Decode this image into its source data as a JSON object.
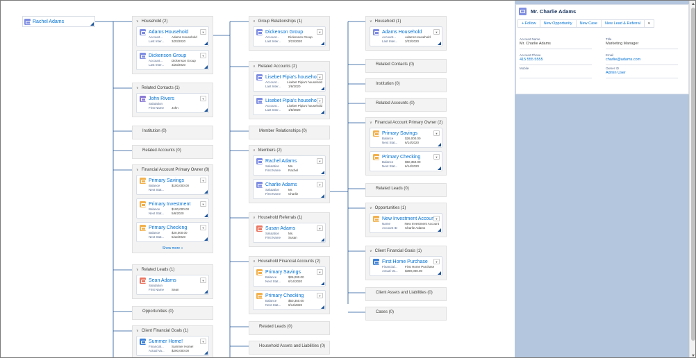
{
  "root": {
    "name": "Rachel Adams",
    "icon": "household-icon"
  },
  "columns": [
    {
      "groups": [
        {
          "title": "Household (2)",
          "cards": [
            {
              "icon": "household-icon",
              "color": "blue",
              "name": "Adams Household",
              "fields": [
                [
                  "Account...",
                  "Adams Household"
                ],
                [
                  "Last Inter...",
                  "3/23/2020"
                ]
              ]
            },
            {
              "icon": "household-icon",
              "color": "blue",
              "name": "Dickenson Group",
              "fields": [
                [
                  "Account...",
                  "Dickenson Group"
                ],
                [
                  "Last Inter...",
                  "3/23/2020"
                ]
              ]
            }
          ]
        },
        {
          "title": "Related Contacts (1)",
          "cards": [
            {
              "icon": "contact-icon",
              "color": "purple",
              "name": "John Rivers",
              "fields": [
                [
                  "Salutation",
                  ""
                ],
                [
                  "First Name",
                  "John"
                ]
              ]
            }
          ]
        },
        {
          "title": "Institution (0)",
          "cards": []
        },
        {
          "title": "Related Accounts (0)",
          "cards": []
        },
        {
          "title": "Financial Account Primary Owner (8)",
          "show_more": "Show more »",
          "cards": [
            {
              "icon": "financial-account-icon",
              "color": "orange",
              "name": "Primary Savings",
              "fields": [
                [
                  "Balance",
                  "$100,000.00"
                ],
                [
                  "Next Stat...",
                  ""
                ]
              ]
            },
            {
              "icon": "financial-account-icon",
              "color": "orange",
              "name": "Primary Investment",
              "fields": [
                [
                  "Balance",
                  "$100,000.00"
                ],
                [
                  "Next Stat...",
                  "5/6/2020"
                ]
              ]
            },
            {
              "icon": "financial-account-icon",
              "color": "orange",
              "name": "Primary Checking",
              "fields": [
                [
                  "Balance",
                  "$20,000.00"
                ],
                [
                  "Next Stat...",
                  "5/12/2020"
                ]
              ]
            }
          ]
        },
        {
          "title": "Related Leads (1)",
          "cards": [
            {
              "icon": "lead-icon",
              "color": "red",
              "name": "Sean Adams",
              "fields": [
                [
                  "Salutation",
                  ""
                ],
                [
                  "First Name",
                  "Sean"
                ]
              ]
            }
          ]
        },
        {
          "title": "Opportunities (0)",
          "cards": []
        },
        {
          "title": "Client Financial Goals (1)",
          "cards": [
            {
              "icon": "goal-icon",
              "color": "sblue",
              "name": "Summer Home!",
              "fields": [
                [
                  "Financial...",
                  "Summer Home!"
                ],
                [
                  "Actual Va...",
                  "$290,000.00"
                ]
              ]
            }
          ]
        }
      ]
    },
    {
      "groups": [
        {
          "title": "Group Relationships (1)",
          "cards": [
            {
              "icon": "household-icon",
              "color": "blue",
              "name": "Dickenson Group",
              "fields": [
                [
                  "Account...",
                  "Dickenson Group"
                ],
                [
                  "Last Inter...",
                  "3/23/2020"
                ]
              ]
            }
          ]
        },
        {
          "title": "Related Accounts (2)",
          "cards": [
            {
              "icon": "household-icon",
              "color": "blue",
              "name": "Lisebet Pipia's household",
              "fields": [
                [
                  "Account...",
                  "Lisebet Pipia's household"
                ],
                [
                  "Last Inter...",
                  "1/8/2020"
                ]
              ]
            },
            {
              "icon": "household-icon",
              "color": "blue",
              "name": "Lisebet Pipia's household",
              "fields": [
                [
                  "Account...",
                  "Lisebet Pipia's household"
                ],
                [
                  "Last Inter...",
                  "1/8/2020"
                ]
              ]
            }
          ]
        },
        {
          "title": "Member Relationships (0)",
          "cards": []
        },
        {
          "title": "Members (2)",
          "cards": [
            {
              "icon": "contact-icon",
              "color": "blue",
              "name": "Rachel Adams",
              "fields": [
                [
                  "Salutation",
                  "Ms."
                ],
                [
                  "First Name",
                  "Rachel"
                ]
              ]
            },
            {
              "icon": "contact-icon",
              "color": "blue",
              "name": "Charlie Adams",
              "fields": [
                [
                  "Salutation",
                  "Mr."
                ],
                [
                  "First Name",
                  "Charlie"
                ]
              ]
            }
          ]
        },
        {
          "title": "Household Referrals (1)",
          "cards": [
            {
              "icon": "lead-icon",
              "color": "red",
              "name": "Susan Adams",
              "fields": [
                [
                  "Salutation",
                  "Ms."
                ],
                [
                  "First Name",
                  "Susan"
                ]
              ]
            }
          ]
        },
        {
          "title": "Household Financial Accounts (2)",
          "cards": [
            {
              "icon": "financial-account-icon",
              "color": "orange",
              "name": "Primary Savings",
              "fields": [
                [
                  "Balance",
                  "$26,000.00"
                ],
                [
                  "Next Stat...",
                  "6/14/2020"
                ]
              ]
            },
            {
              "icon": "financial-account-icon",
              "color": "orange",
              "name": "Primary Checking",
              "fields": [
                [
                  "Balance",
                  "$50,350.00"
                ],
                [
                  "Next Stat...",
                  "6/14/2020"
                ]
              ]
            }
          ]
        },
        {
          "title": "Related Leads (0)",
          "cards": []
        },
        {
          "title": "Household Assets and Liabilities (0)",
          "cards": []
        }
      ]
    },
    {
      "groups": [
        {
          "title": "Household (1)",
          "cards": [
            {
              "icon": "household-icon",
              "color": "blue",
              "name": "Adams Household",
              "fields": [
                [
                  "Account...",
                  "Adams Household"
                ],
                [
                  "Last Inter...",
                  "3/23/2020"
                ]
              ]
            }
          ]
        },
        {
          "title": "Related Contacts (0)",
          "cards": []
        },
        {
          "title": "Institution (0)",
          "cards": []
        },
        {
          "title": "Related Accounts (0)",
          "cards": []
        },
        {
          "title": "Financial Account Primary Owner (2)",
          "cards": [
            {
              "icon": "financial-account-icon",
              "color": "orange",
              "name": "Primary Savings",
              "fields": [
                [
                  "Balance",
                  "$26,000.00"
                ],
                [
                  "Next Stat...",
                  "6/14/2020"
                ]
              ]
            },
            {
              "icon": "financial-account-icon",
              "color": "orange",
              "name": "Primary Checking",
              "fields": [
                [
                  "Balance",
                  "$50,350.00"
                ],
                [
                  "Next Stat...",
                  "6/14/2020"
                ]
              ]
            }
          ]
        },
        {
          "title": "Related Leads (0)",
          "cards": []
        },
        {
          "title": "Opportunities (1)",
          "cards": [
            {
              "icon": "opportunity-icon",
              "color": "orange",
              "name": "New Investment Account",
              "fields": [
                [
                  "Name",
                  "New Investment Account"
                ],
                [
                  "Account ID",
                  "Charlie Adams"
                ]
              ]
            }
          ]
        },
        {
          "title": "Client Financial Goals (1)",
          "cards": [
            {
              "icon": "goal-icon",
              "color": "sblue",
              "name": "First Home Purchase",
              "fields": [
                [
                  "Financial...",
                  "First Home Purchase"
                ],
                [
                  "Actual Va...",
                  "$390,000.00"
                ]
              ]
            }
          ]
        },
        {
          "title": "Client Assets and Liabilities (0)",
          "cards": []
        },
        {
          "title": "Cases (0)",
          "cards": []
        }
      ]
    }
  ],
  "detail": {
    "title": "Mr. Charlie Adams",
    "icon": "contact-icon",
    "actions": [
      "+ Follow",
      "New Opportunity",
      "New Case",
      "New Lead & Referral"
    ],
    "menu_glyph": "▾",
    "fields": [
      {
        "label": "Account Name",
        "value": "Mr. Charlie Adams",
        "link": false
      },
      {
        "label": "Title",
        "value": "Marketing Manager",
        "link": false
      },
      {
        "label": "Account Phone",
        "value": "415 555 5555",
        "link": true
      },
      {
        "label": "Email",
        "value": "charlie@adams.com",
        "link": true
      },
      {
        "label": "Mobile",
        "value": "",
        "link": false
      },
      {
        "label": "Owner ID",
        "value": "Admin User",
        "link": true
      }
    ]
  },
  "colors": {
    "link": "#0070d2",
    "group_bg": "#f3f3f3",
    "panel_bg": "#b4c6de",
    "connector": "#1b5297"
  }
}
